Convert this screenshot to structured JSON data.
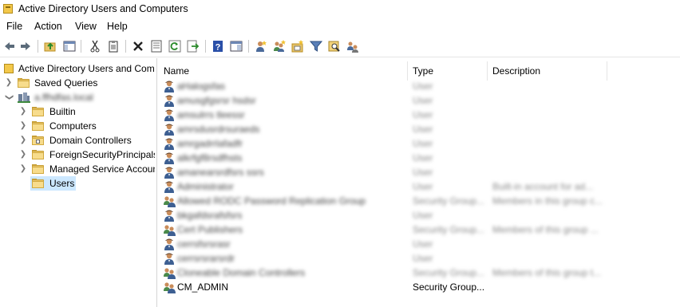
{
  "window": {
    "title": "Active Directory Users and Computers"
  },
  "menu": [
    "File",
    "Action",
    "View",
    "Help"
  ],
  "toolbar": {
    "buttons": [
      "back-icon",
      "forward-icon",
      "up-folder-icon",
      "show-hide-console-tree-icon",
      "cut-icon",
      "paste-icon",
      "delete-icon",
      "properties-icon",
      "refresh-icon",
      "export-list-icon",
      "help-icon",
      "action-pane-icon",
      "new-user-icon",
      "new-group-icon",
      "new-ou-icon",
      "filter-icon",
      "find-icon",
      "add-to-group-icon"
    ]
  },
  "tree": {
    "root": "Active Directory Users and Com",
    "items": [
      {
        "label": "Saved Queries"
      },
      {
        "label": "a.ffhdfas.local"
      },
      {
        "label": "Builtin"
      },
      {
        "label": "Computers"
      },
      {
        "label": "Domain Controllers"
      },
      {
        "label": "ForeignSecurityPrincipals"
      },
      {
        "label": "Managed Service Accounts"
      },
      {
        "label": "Users"
      }
    ]
  },
  "list": {
    "columns": [
      "Name",
      "Type",
      "Description"
    ],
    "rows": [
      {
        "name": "aHalogsfas",
        "type": "User",
        "desc": "",
        "kind": "user"
      },
      {
        "name": "amusgfgsrsr hsdsr",
        "type": "User",
        "desc": "",
        "kind": "user"
      },
      {
        "name": "amsulrrs tleessr",
        "type": "User",
        "desc": "",
        "kind": "user"
      },
      {
        "name": "amrsdusrdrsuraeds",
        "type": "User",
        "desc": "",
        "kind": "user"
      },
      {
        "name": "amrgadrrlafadfr",
        "type": "User",
        "desc": "",
        "kind": "user"
      },
      {
        "name": "alkrfgf8rsdfhsts",
        "type": "User",
        "desc": "",
        "kind": "user"
      },
      {
        "name": "amanearsrdfsrs ssrs",
        "type": "User",
        "desc": "",
        "kind": "user"
      },
      {
        "name": "Administrator",
        "type": "User",
        "desc": "Built-in account for ad...",
        "kind": "user"
      },
      {
        "name": "Allowed RODC Password Replication Group",
        "type": "Security Group...",
        "desc": "Members in this group c...",
        "kind": "group"
      },
      {
        "name": "bkgafdsrafsfsrs",
        "type": "User",
        "desc": "",
        "kind": "user"
      },
      {
        "name": "Cert Publishers",
        "type": "Security Group...",
        "desc": "Members of this group ...",
        "kind": "group"
      },
      {
        "name": "cerrsfsrsrasr",
        "type": "User",
        "desc": "",
        "kind": "user"
      },
      {
        "name": "cerrsrsrarsrdr",
        "type": "User",
        "desc": "",
        "kind": "user"
      },
      {
        "name": "Cloneable Domain Controllers",
        "type": "Security Group...",
        "desc": "Members of this group t...",
        "kind": "group"
      },
      {
        "name": "CM_ADMIN",
        "type": "Security Group...",
        "desc": "",
        "kind": "group"
      }
    ]
  }
}
